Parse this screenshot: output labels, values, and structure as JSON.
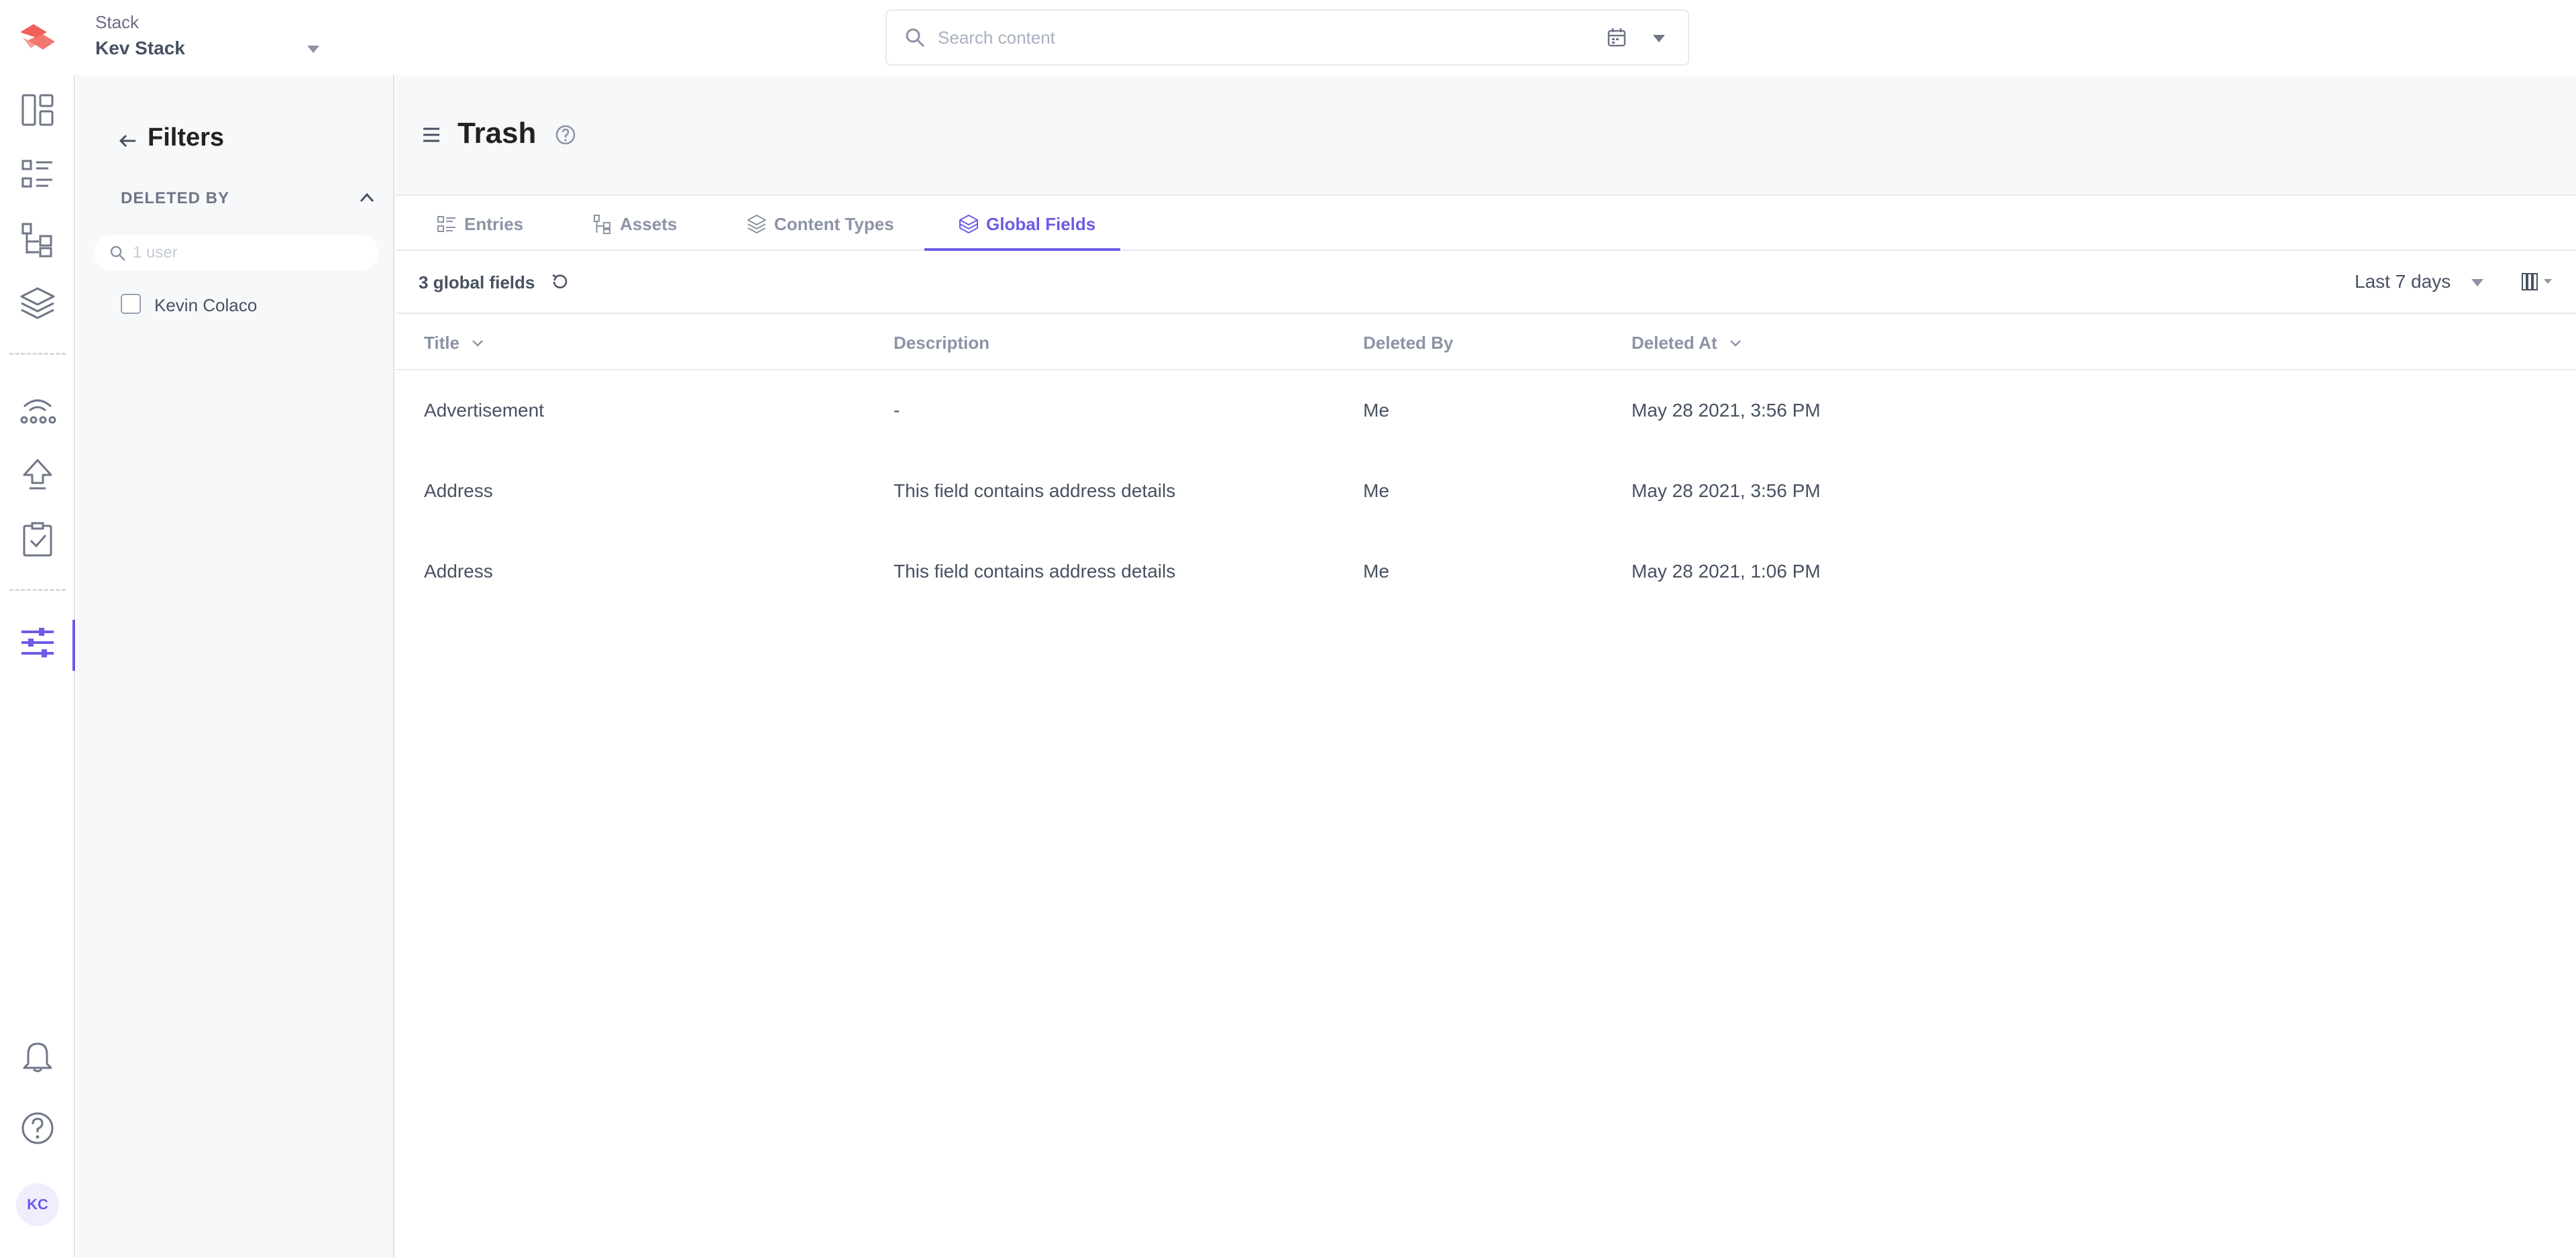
{
  "header": {
    "stack_label": "Stack",
    "stack_name": "Kev Stack",
    "search_placeholder": "Search content"
  },
  "rail": {
    "icons": [
      "dashboard-icon",
      "entries-icon",
      "content-models-icon",
      "stack-layers-icon",
      "workflows-icon",
      "deploy-icon",
      "releases-icon",
      "settings-icon",
      "notifications-icon",
      "help-icon"
    ],
    "active": "settings-icon",
    "avatar_initials": "KC"
  },
  "filters": {
    "title": "Filters",
    "section_title": "DELETED BY",
    "search_placeholder": "1 user",
    "options": [
      {
        "label": "Kevin Colaco",
        "checked": false
      }
    ]
  },
  "page": {
    "title": "Trash",
    "tabs": [
      {
        "label": "Entries",
        "icon": "entries-icon"
      },
      {
        "label": "Assets",
        "icon": "assets-icon"
      },
      {
        "label": "Content Types",
        "icon": "content-types-icon"
      },
      {
        "label": "Global Fields",
        "icon": "global-fields-icon",
        "active": true
      }
    ],
    "count_label": "3 global fields",
    "date_range": "Last 7 days"
  },
  "table": {
    "columns": [
      "Title",
      "Description",
      "Deleted By",
      "Deleted At"
    ],
    "rows": [
      {
        "title": "Advertisement",
        "description": "-",
        "deleted_by": "Me",
        "deleted_at": "May 28 2021, 3:56 PM"
      },
      {
        "title": "Address",
        "description": "This field contains address details",
        "deleted_by": "Me",
        "deleted_at": "May 28 2021, 3:56 PM"
      },
      {
        "title": "Address",
        "description": "This field contains address details",
        "deleted_by": "Me",
        "deleted_at": "May 28 2021, 1:06 PM"
      }
    ]
  },
  "colors": {
    "accent": "#6c5ce7",
    "text": "#475161",
    "muted": "#8c93a5",
    "logo": "#f05f58"
  }
}
